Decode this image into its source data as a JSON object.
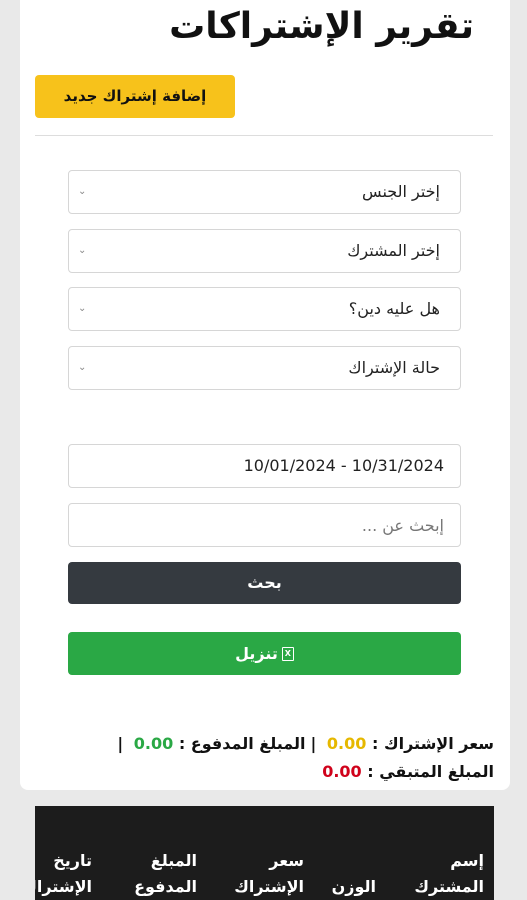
{
  "header": {
    "title": "تقرير الإشتراكات",
    "add_button_label": "إضافة إشتراك جديد"
  },
  "filters": {
    "gender_select": "إختر الجنس",
    "subscriber_select": "إختر المشترك",
    "debt_select": "هل عليه دين؟",
    "status_select": "حالة الإشتراك",
    "date_range": "10/01/2024 - 10/31/2024",
    "search_placeholder": "إبحث عن ...",
    "search_button_label": "بحث",
    "download_button_label": "تنزيل",
    "download_icon_glyph": "X"
  },
  "summary": {
    "price_label": "سعر الإشتراك :",
    "price_value": "0.00",
    "paid_label": "المبلغ المدفوع :",
    "paid_value": "0.00",
    "remaining_label": "المبلغ المتبقي :",
    "remaining_value": "0.00",
    "separator": "|"
  },
  "table": {
    "columns": [
      {
        "line1": "إسم",
        "line2": "المشترك"
      },
      {
        "line1": "",
        "line2": "الوزن"
      },
      {
        "line1": "سعر",
        "line2": "الإشتراك"
      },
      {
        "line1": "المبلغ",
        "line2": "المدفوع"
      },
      {
        "line1": "تاريخ",
        "line2": "الإشتراك"
      }
    ]
  },
  "colors": {
    "accent_yellow": "#f7c21b",
    "dark_button": "#353a40",
    "green_button": "#2aa845",
    "value_red": "#d0021b"
  }
}
